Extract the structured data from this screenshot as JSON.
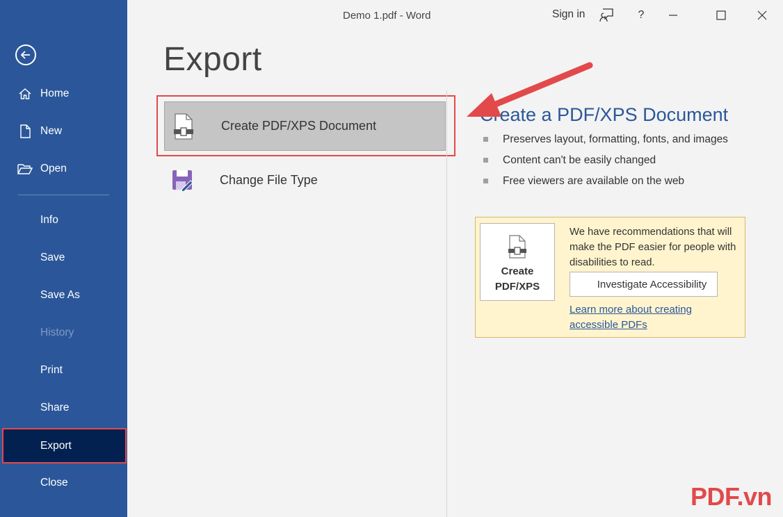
{
  "window": {
    "title": "Demo 1.pdf  -  Word",
    "sign_in": "Sign in",
    "help": "?"
  },
  "sidebar": {
    "items": [
      {
        "label": "Home",
        "icon": "home-icon"
      },
      {
        "label": "New",
        "icon": "new-document-icon"
      },
      {
        "label": "Open",
        "icon": "folder-open-icon"
      },
      {
        "label": "Info"
      },
      {
        "label": "Save"
      },
      {
        "label": "Save As"
      },
      {
        "label": "History"
      },
      {
        "label": "Print"
      },
      {
        "label": "Share"
      },
      {
        "label": "Export"
      },
      {
        "label": "Close"
      }
    ],
    "accent": "#2b579a",
    "active_bg": "#022050"
  },
  "main": {
    "title": "Export",
    "options": [
      {
        "label": "Create PDF/XPS Document",
        "icon": "pdf-document-icon",
        "selected": true
      },
      {
        "label": "Change File Type",
        "icon": "change-file-type-icon",
        "selected": false
      }
    ]
  },
  "detail": {
    "title": "Create a PDF/XPS Document",
    "bullets": [
      "Preserves layout, formatting, fonts, and images",
      "Content can't be easily changed",
      "Free viewers are available on the web"
    ],
    "button_line1": "Create",
    "button_line2": "PDF/XPS",
    "recommendation": "We have recommendations that will make the PDF easier for people with disabilities to read.",
    "investigate_label": "Investigate Accessibility",
    "learn_more": "Learn more about creating accessible PDFs"
  },
  "watermark": "PDF.vn",
  "highlight_color": "#e2494b"
}
